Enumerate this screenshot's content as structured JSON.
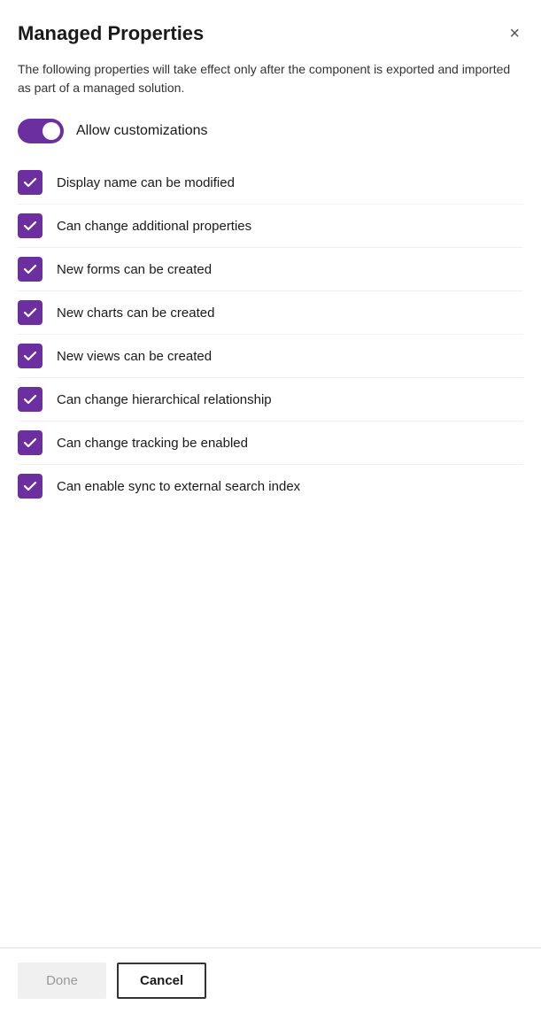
{
  "dialog": {
    "title": "Managed Properties",
    "description": "The following properties will take effect only after the component is exported and imported as part of a managed solution.",
    "close_label": "×"
  },
  "toggle": {
    "label": "Allow customizations",
    "checked": true
  },
  "checkboxes": [
    {
      "label": "Display name can be modified",
      "checked": true
    },
    {
      "label": "Can change additional properties",
      "checked": true
    },
    {
      "label": "New forms can be created",
      "checked": true
    },
    {
      "label": "New charts can be created",
      "checked": true
    },
    {
      "label": "New views can be created",
      "checked": true
    },
    {
      "label": "Can change hierarchical relationship",
      "checked": true
    },
    {
      "label": "Can change tracking be enabled",
      "checked": true
    },
    {
      "label": "Can enable sync to external search index",
      "checked": true
    }
  ],
  "footer": {
    "done_label": "Done",
    "cancel_label": "Cancel"
  },
  "colors": {
    "accent": "#6b2fa0"
  }
}
